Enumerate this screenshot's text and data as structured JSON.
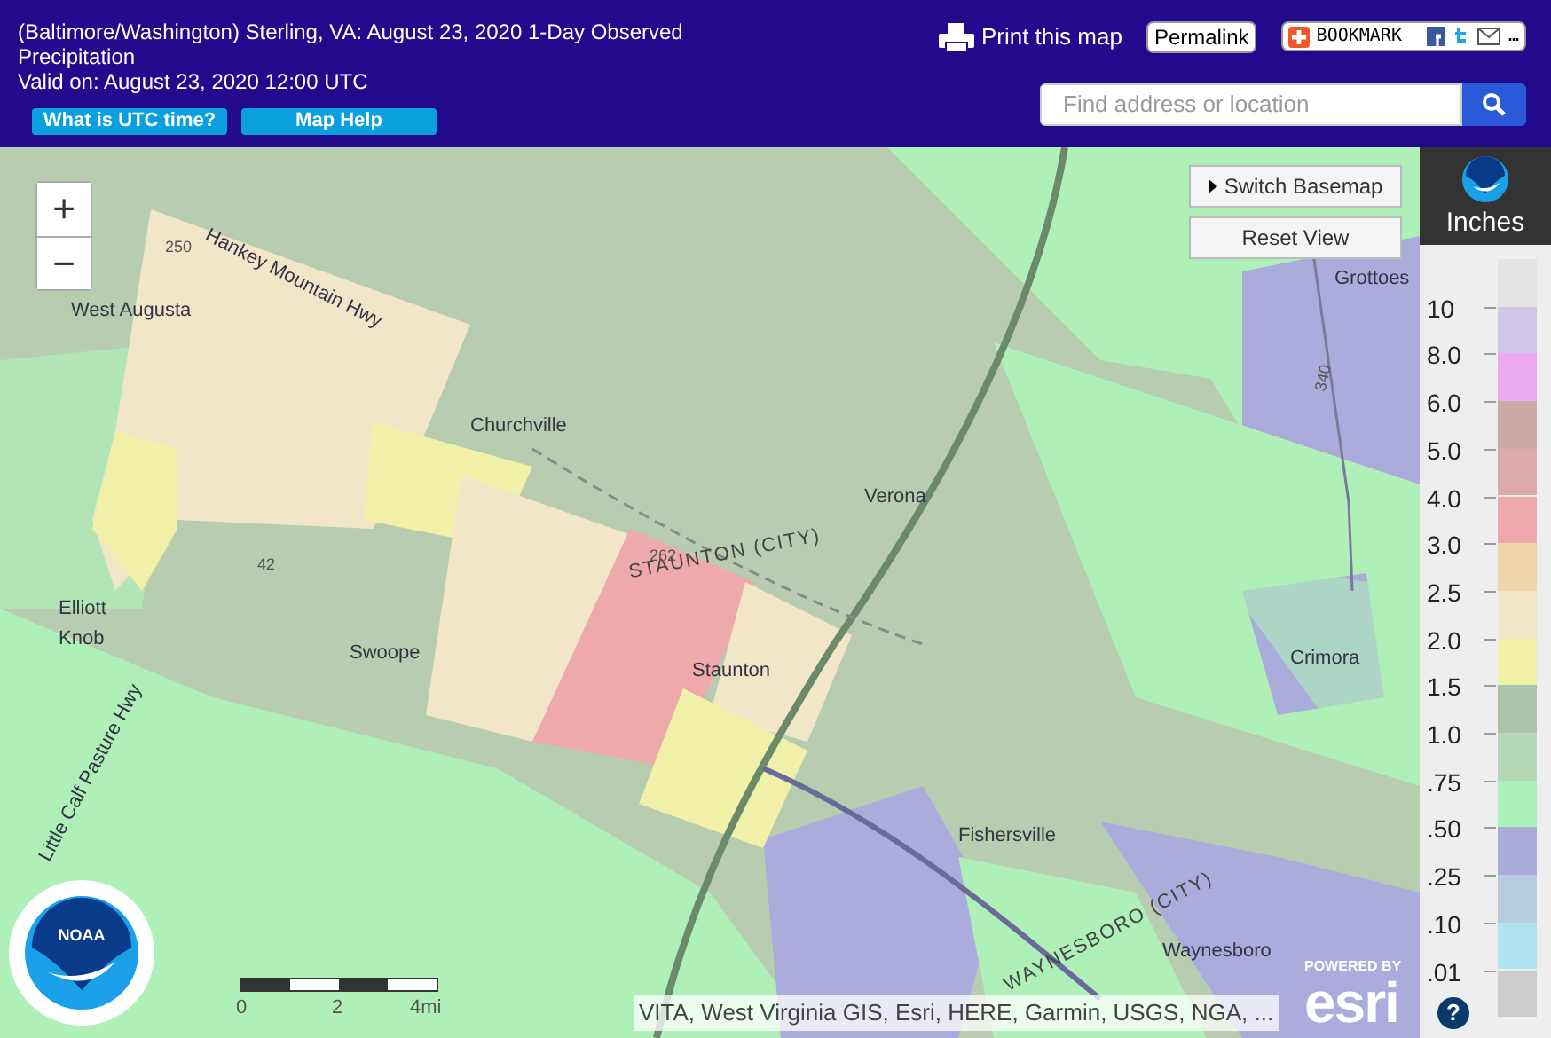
{
  "header": {
    "title": "(Baltimore/Washington) Sterling, VA: August 23, 2020 1-Day Observed Precipitation",
    "valid_on": "Valid on: August 23, 2020 12:00 UTC",
    "buttons": [
      "What is UTC time?",
      "Map Help"
    ],
    "print_link": "Print this map",
    "permalink": "Permalink",
    "bookmark": "BOOKMARK",
    "bookmark_more": "…",
    "search": {
      "placeholder": "Find address or location"
    }
  },
  "map": {
    "zoom_buttons": [
      "+",
      "−"
    ],
    "switch_basemap": "Switch Basemap",
    "reset_view": "Reset View",
    "labels": [
      {
        "text": "West Augusta",
        "kind": "town"
      },
      {
        "text": "Hankey Mountain Hwy",
        "kind": "road"
      },
      {
        "text": "Churchville",
        "kind": "town"
      },
      {
        "text": "Verona",
        "kind": "town"
      },
      {
        "text": "STAUNTON (CITY)",
        "kind": "area"
      },
      {
        "text": "Staunton",
        "kind": "town"
      },
      {
        "text": "Swoope",
        "kind": "town"
      },
      {
        "text": "Elliott Knob",
        "kind": "town"
      },
      {
        "text": "Little Calf Pasture Hwy",
        "kind": "road"
      },
      {
        "text": "Fishersville",
        "kind": "town"
      },
      {
        "text": "WAYNESBORO (CITY)",
        "kind": "area"
      },
      {
        "text": "Waynesboro",
        "kind": "town"
      },
      {
        "text": "Crimora",
        "kind": "town"
      },
      {
        "text": "Grottoes",
        "kind": "town"
      },
      {
        "text": "250",
        "kind": "route"
      },
      {
        "text": "42",
        "kind": "route"
      },
      {
        "text": "262",
        "kind": "route"
      },
      {
        "text": "340",
        "kind": "route"
      }
    ],
    "noaa_logo": "NOAA",
    "scale": [
      "0",
      "2",
      "4mi"
    ],
    "attribution": "VITA, West Virginia GIS, Esri, HERE, Garmin, USGS, NGA, ...",
    "esri_powered": "POWERED BY",
    "esri_logo": "esri"
  },
  "legend": {
    "title": "Inches",
    "segments": [
      {
        "color": "#e4e4e4"
      },
      {
        "color": "#cfc6e8"
      },
      {
        "color": "#eeaaee"
      },
      {
        "color": "#ccaaaa"
      },
      {
        "color": "#dcaaaa"
      },
      {
        "color": "#eeaaaa"
      },
      {
        "color": "#f0d4aa"
      },
      {
        "color": "#f2e6c8"
      },
      {
        "color": "#f0f0a8"
      },
      {
        "color": "#aac4aa"
      },
      {
        "color": "#b4d8b4"
      },
      {
        "color": "#aaf0b8"
      },
      {
        "color": "#aaaad8"
      },
      {
        "color": "#b6cce0"
      },
      {
        "color": "#b0e2f0"
      },
      {
        "color": "#cccccc"
      }
    ],
    "ticks": [
      "10",
      "8.0",
      "6.0",
      "5.0",
      "4.0",
      "3.0",
      "2.5",
      "2.0",
      "1.5",
      "1.0",
      ".75",
      ".50",
      ".25",
      ".10",
      ".01"
    ],
    "help": "?"
  }
}
